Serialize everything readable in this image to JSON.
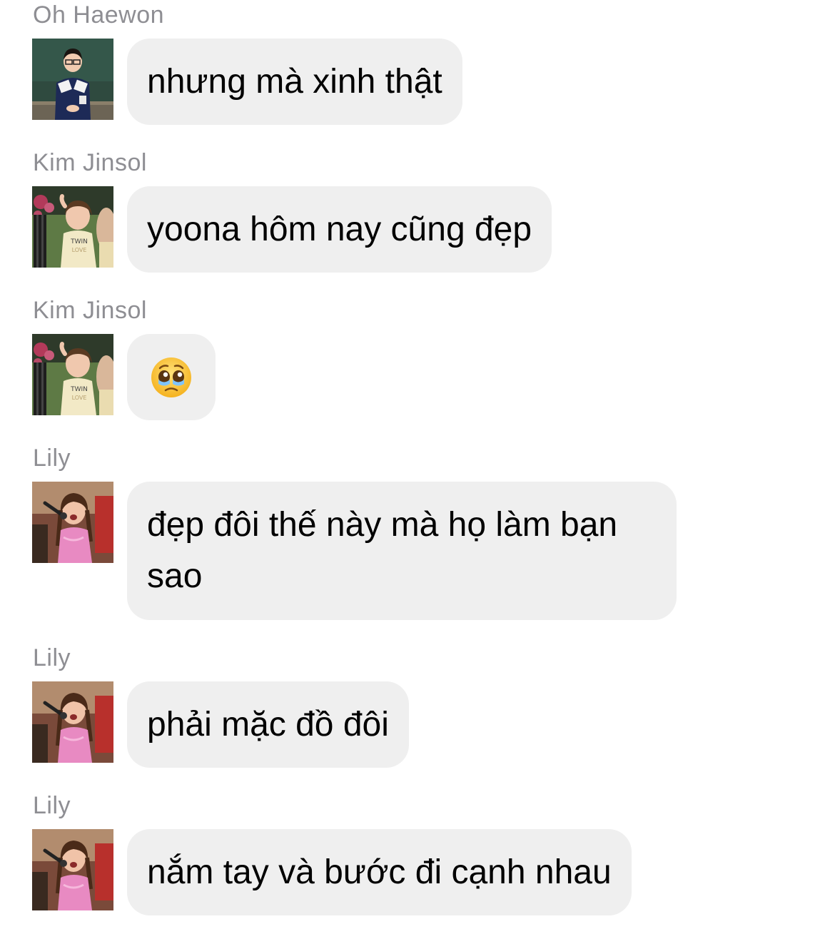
{
  "messages": [
    {
      "sender": "Oh Haewon",
      "text": "nhưng mà xinh thật"
    },
    {
      "sender": "Kim Jinsol",
      "text": "yoona hôm nay cũng đẹp"
    },
    {
      "sender": "Kim Jinsol",
      "text": "🥹"
    },
    {
      "sender": "Lily",
      "text": "đẹp đôi thế này mà họ làm bạn sao"
    },
    {
      "sender": "Lily",
      "text": "phải mặc đồ đôi"
    },
    {
      "sender": "Lily",
      "text": "nắm tay và bước đi cạnh nhau"
    }
  ],
  "colors": {
    "bubble": "#efefef",
    "sender_name": "#8e8e93",
    "text": "#000000"
  },
  "avatars": [
    "classroom-photo",
    "girl-garden-photo",
    "girl-garden-photo",
    "girl-singing-photo",
    "girl-singing-photo",
    "girl-singing-photo"
  ]
}
